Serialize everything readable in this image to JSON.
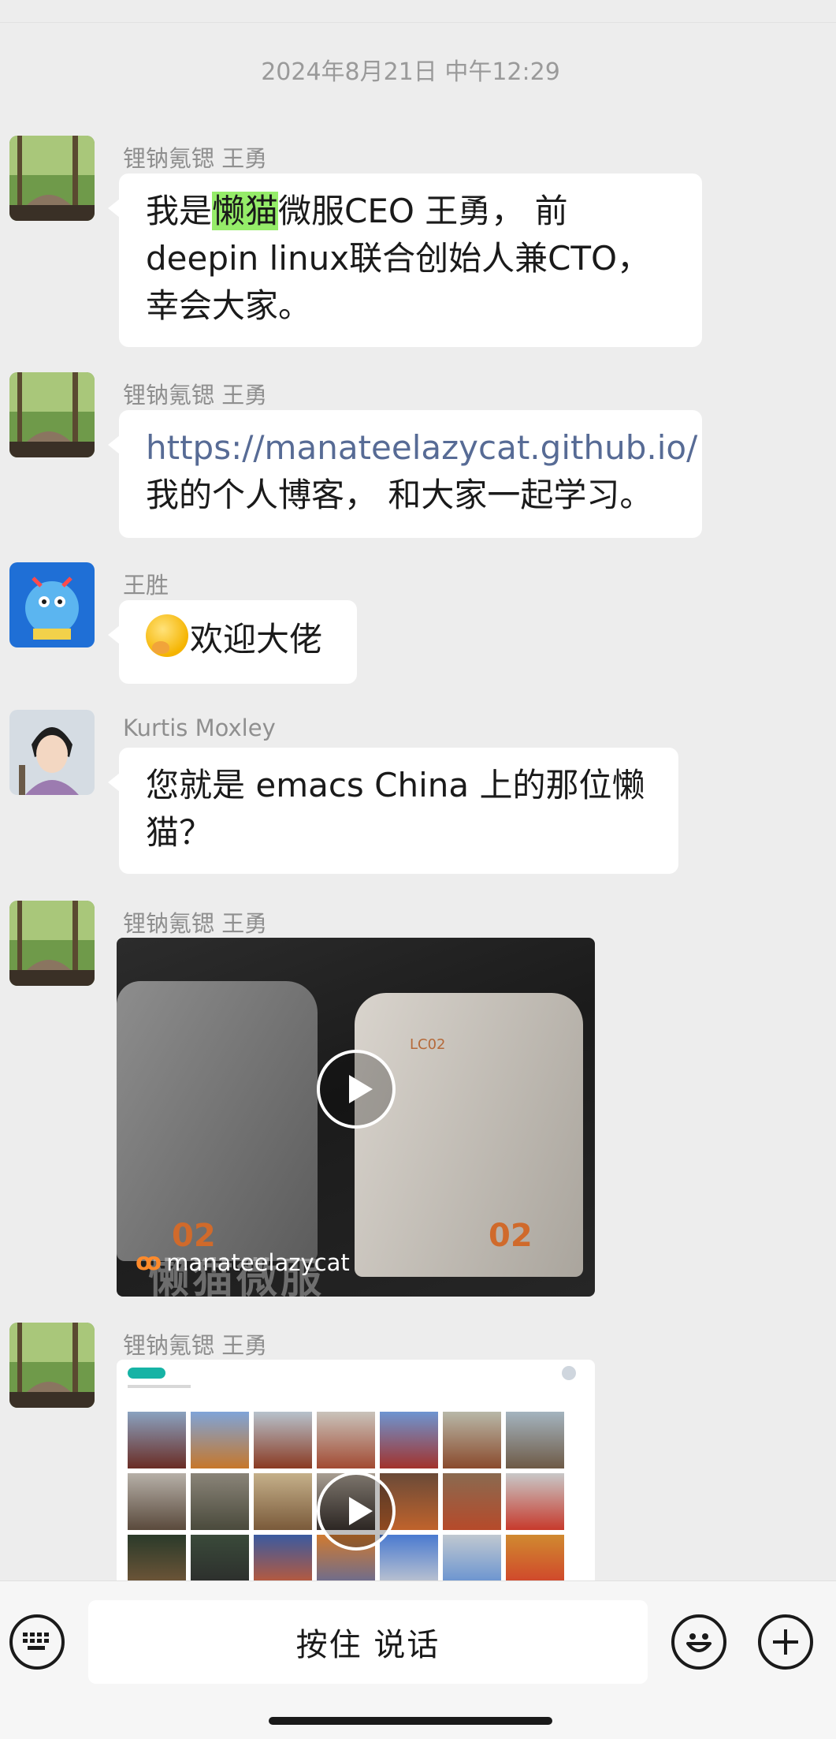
{
  "timestamp": "2024年8月21日 中午12:29",
  "messages": [
    {
      "sender": "锂钠氪锶 王勇",
      "text_before": "我是",
      "highlight": "懒猫",
      "text_after": "微服CEO 王勇， 前 deepin linux联合创始人兼CTO， 幸会大家。"
    },
    {
      "sender": "锂钠氪锶 王勇",
      "link": "https://manateelazycat.github.io/",
      "text": "我的个人博客， 和大家一起学习。"
    },
    {
      "sender": "王胜",
      "text": "欢迎大佬",
      "emoji": "shushing-face-emoji"
    },
    {
      "sender": "Kurtis Moxley",
      "text": "您就是 emacs China 上的那位懒猫？"
    },
    {
      "sender": "锂钠氪锶 王勇",
      "video": {
        "watermark": "manateelazycat",
        "overlay_text": "懒猫微服",
        "product_label": "02",
        "device_label": "LC02"
      }
    },
    {
      "sender": "锂钠氪锶 王勇",
      "video": {}
    }
  ],
  "input_bar": {
    "voice_label": "按住 说话",
    "keyboard_icon": "keyboard-icon",
    "emoji_icon": "emoji-icon",
    "plus_icon": "plus-icon"
  },
  "colors": {
    "background": "#ededed",
    "bubble": "#ffffff",
    "highlight": "#95ec69",
    "link": "#576b95"
  }
}
